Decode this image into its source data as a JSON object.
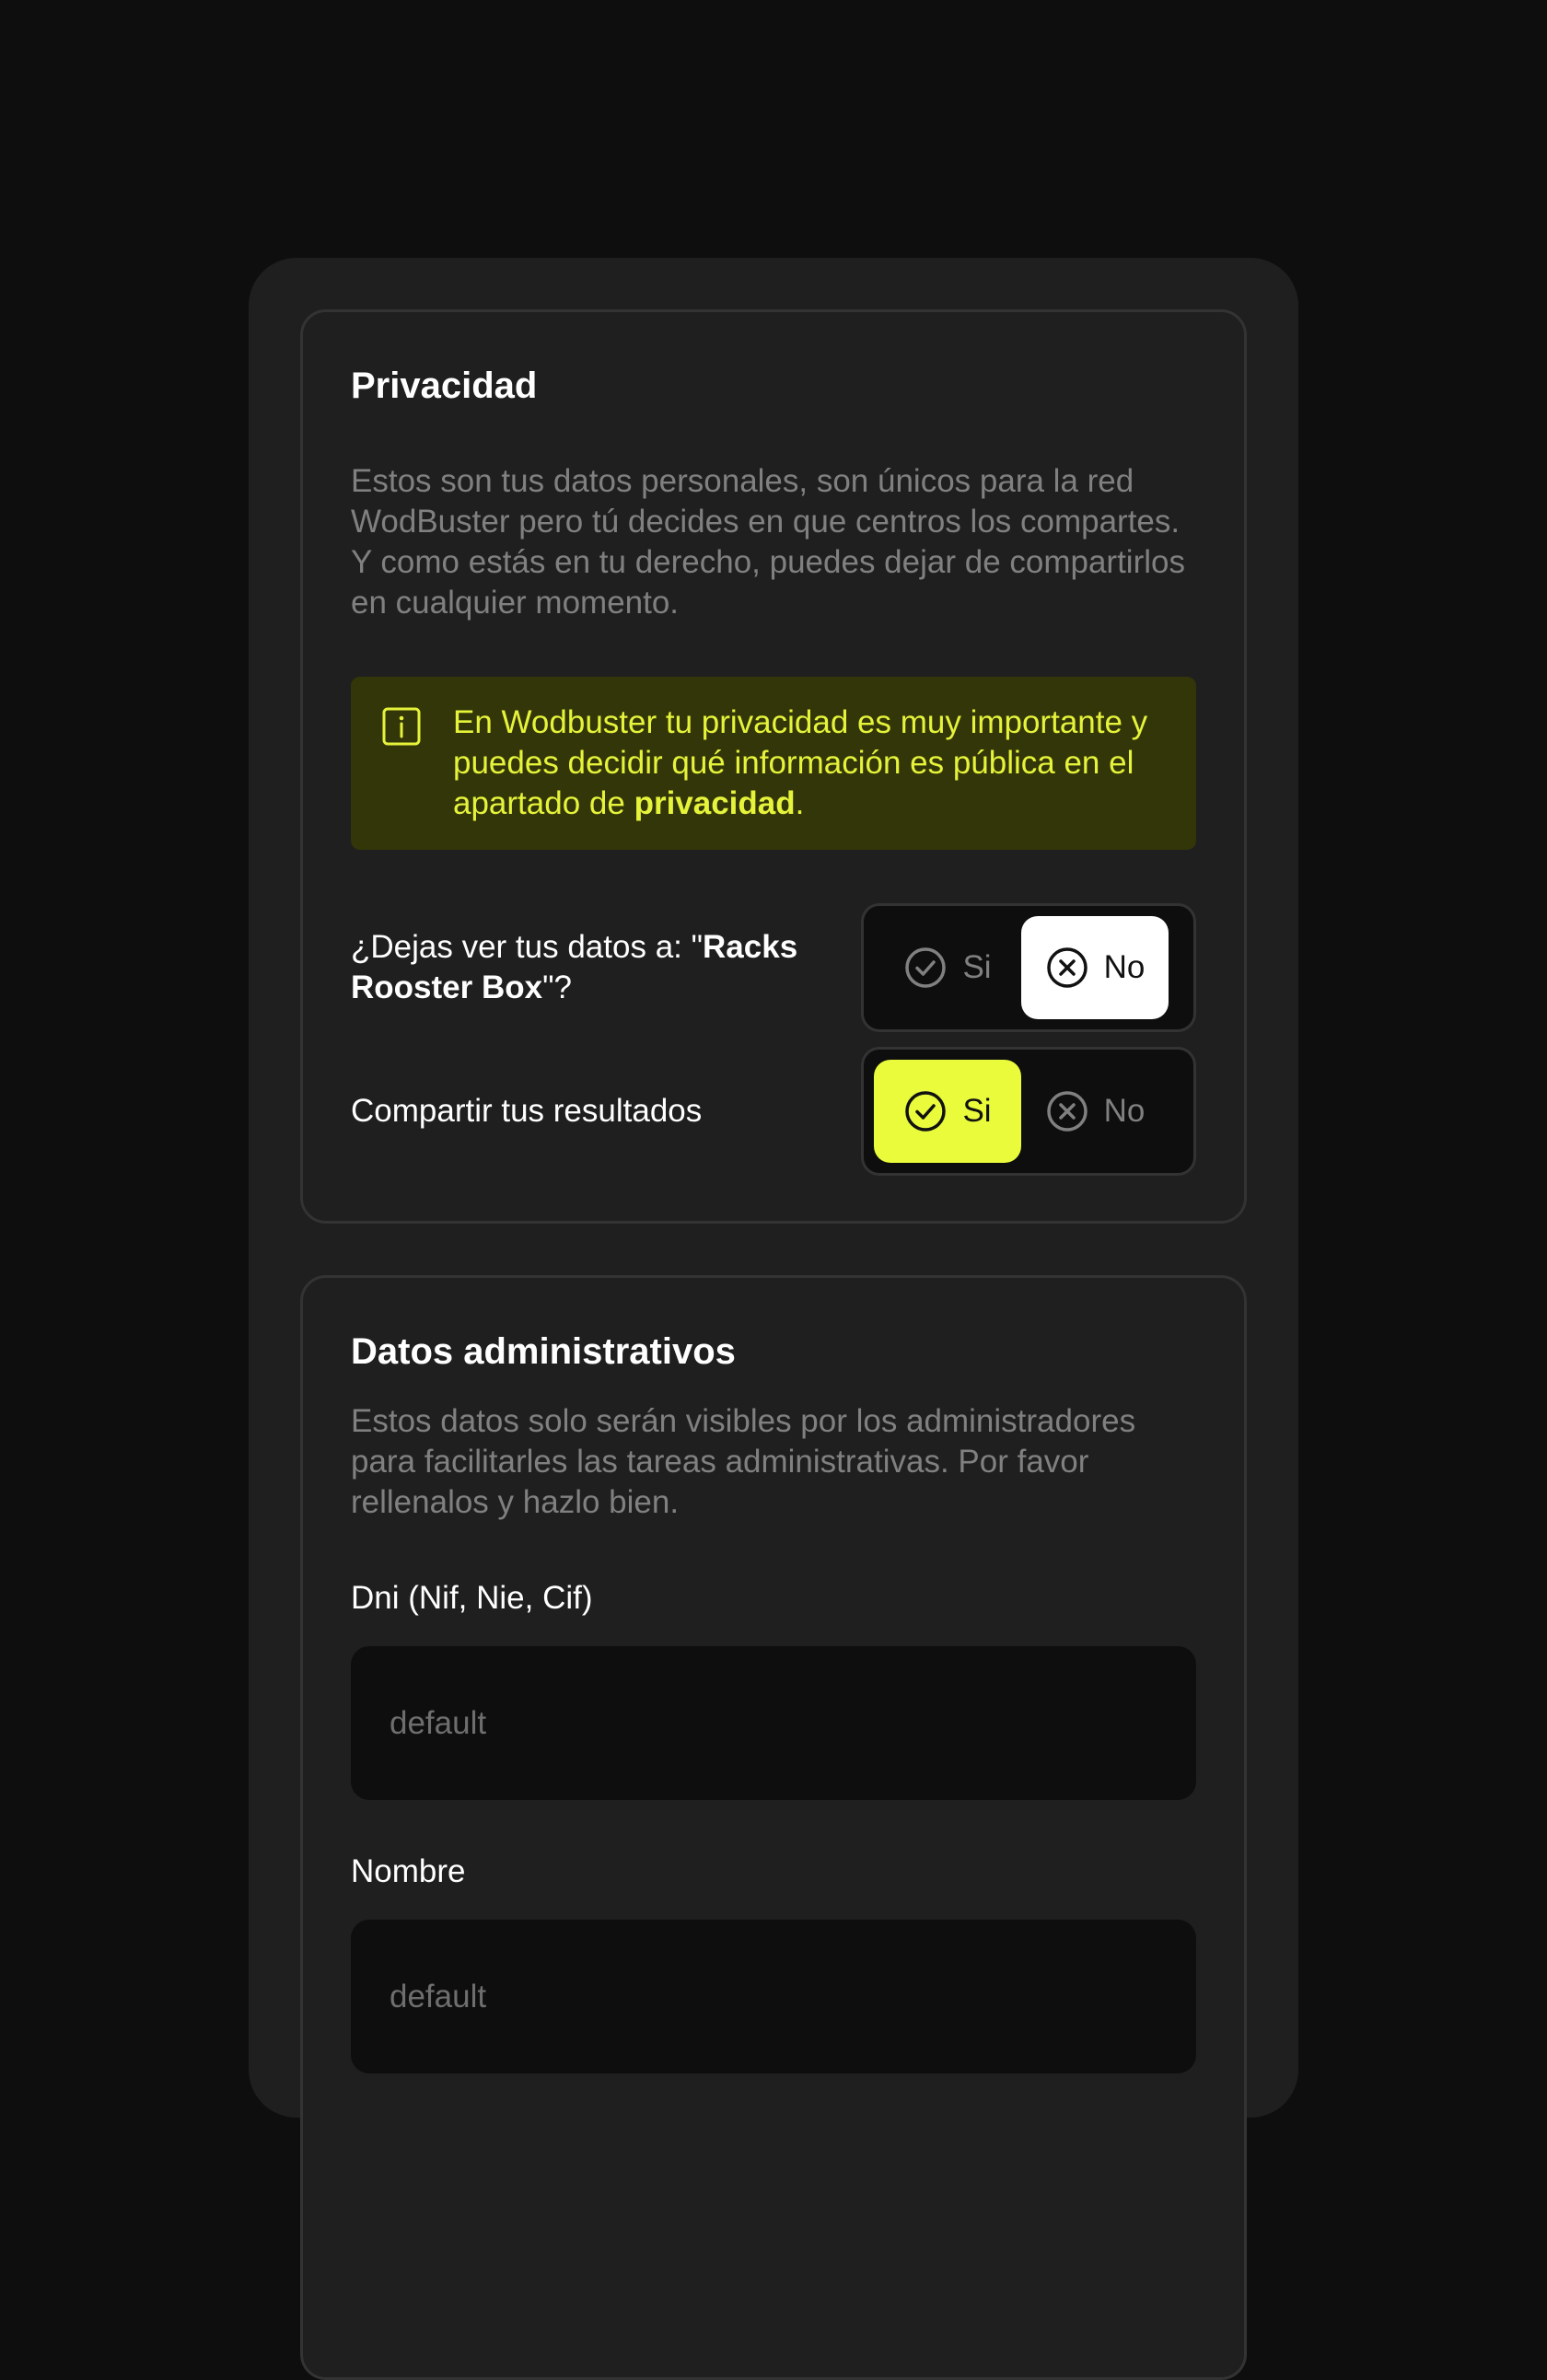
{
  "privacy": {
    "title": "Privacidad",
    "description": "Estos son tus datos personales, son únicos para la red WodBuster pero tú decides en que centros los compartes. Y como estás en tu derecho, puedes dejar de compartirlos en cualquier momento.",
    "notice": {
      "icon": "info-icon",
      "text_before": "En Wodbuster tu privacidad es muy importante y puedes decidir qué información es pública en el apartado de ",
      "link": "privacidad",
      "text_after": ".",
      "color": "#e5f33b",
      "background": "#333608"
    },
    "share_data": {
      "label_before": "¿Dejas ver tus datos a: \"",
      "box_name": "Racks Rooster Box",
      "label_after": "\"?",
      "yes_label": "Si",
      "no_label": "No",
      "selected": "No"
    },
    "share_results": {
      "label": "Compartir tus resultados",
      "yes_label": "Si",
      "no_label": "No",
      "selected": "Si"
    }
  },
  "admin": {
    "title": "Datos administrativos",
    "description": "Estos datos solo serán visibles por los administradores para facilitarles las tareas administrativas. Por favor rellenalos y hazlo bien.",
    "fields": [
      {
        "label": "Dni (Nif, Nie, Cif)",
        "placeholder": "default",
        "value": ""
      },
      {
        "label": "Nombre",
        "placeholder": "default",
        "value": ""
      }
    ]
  },
  "colors": {
    "accent": "#e9fb3b",
    "background": "#0e0e0e",
    "surface": "#1f1f1f"
  }
}
